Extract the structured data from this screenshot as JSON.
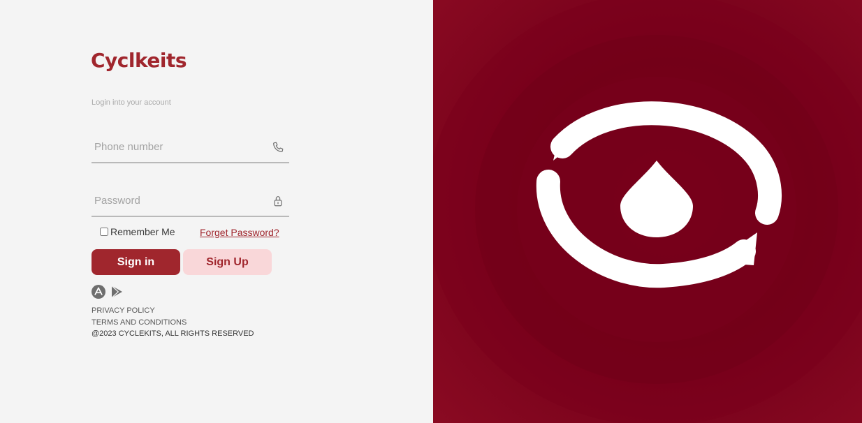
{
  "brand": {
    "name": "Cyclkeits"
  },
  "login": {
    "subtitle": "Login into your account",
    "phone_placeholder": "Phone number",
    "password_placeholder": "Password",
    "remember_label": "Remember Me",
    "forgot_label": "Forget Password?",
    "signin_label": "Sign in",
    "signup_label": "Sign Up"
  },
  "icons": {
    "phone": "phone-icon",
    "password": "lock-icon",
    "app_store": "app-store-icon",
    "play_store": "play-store-icon",
    "hero": "blood-drop-cycle-icon"
  },
  "footer": {
    "privacy": "PRIVACY POLICY",
    "terms": "TERMS AND CONDITIONS",
    "copyright": "@2023 CYCLEKITS, ALL RIGHTS RESERVED"
  },
  "colors": {
    "brand": "#a0262d",
    "signup_bg": "#f9d7d9",
    "panel_dark": "#7a0019",
    "left_bg": "#f4f4f4"
  }
}
